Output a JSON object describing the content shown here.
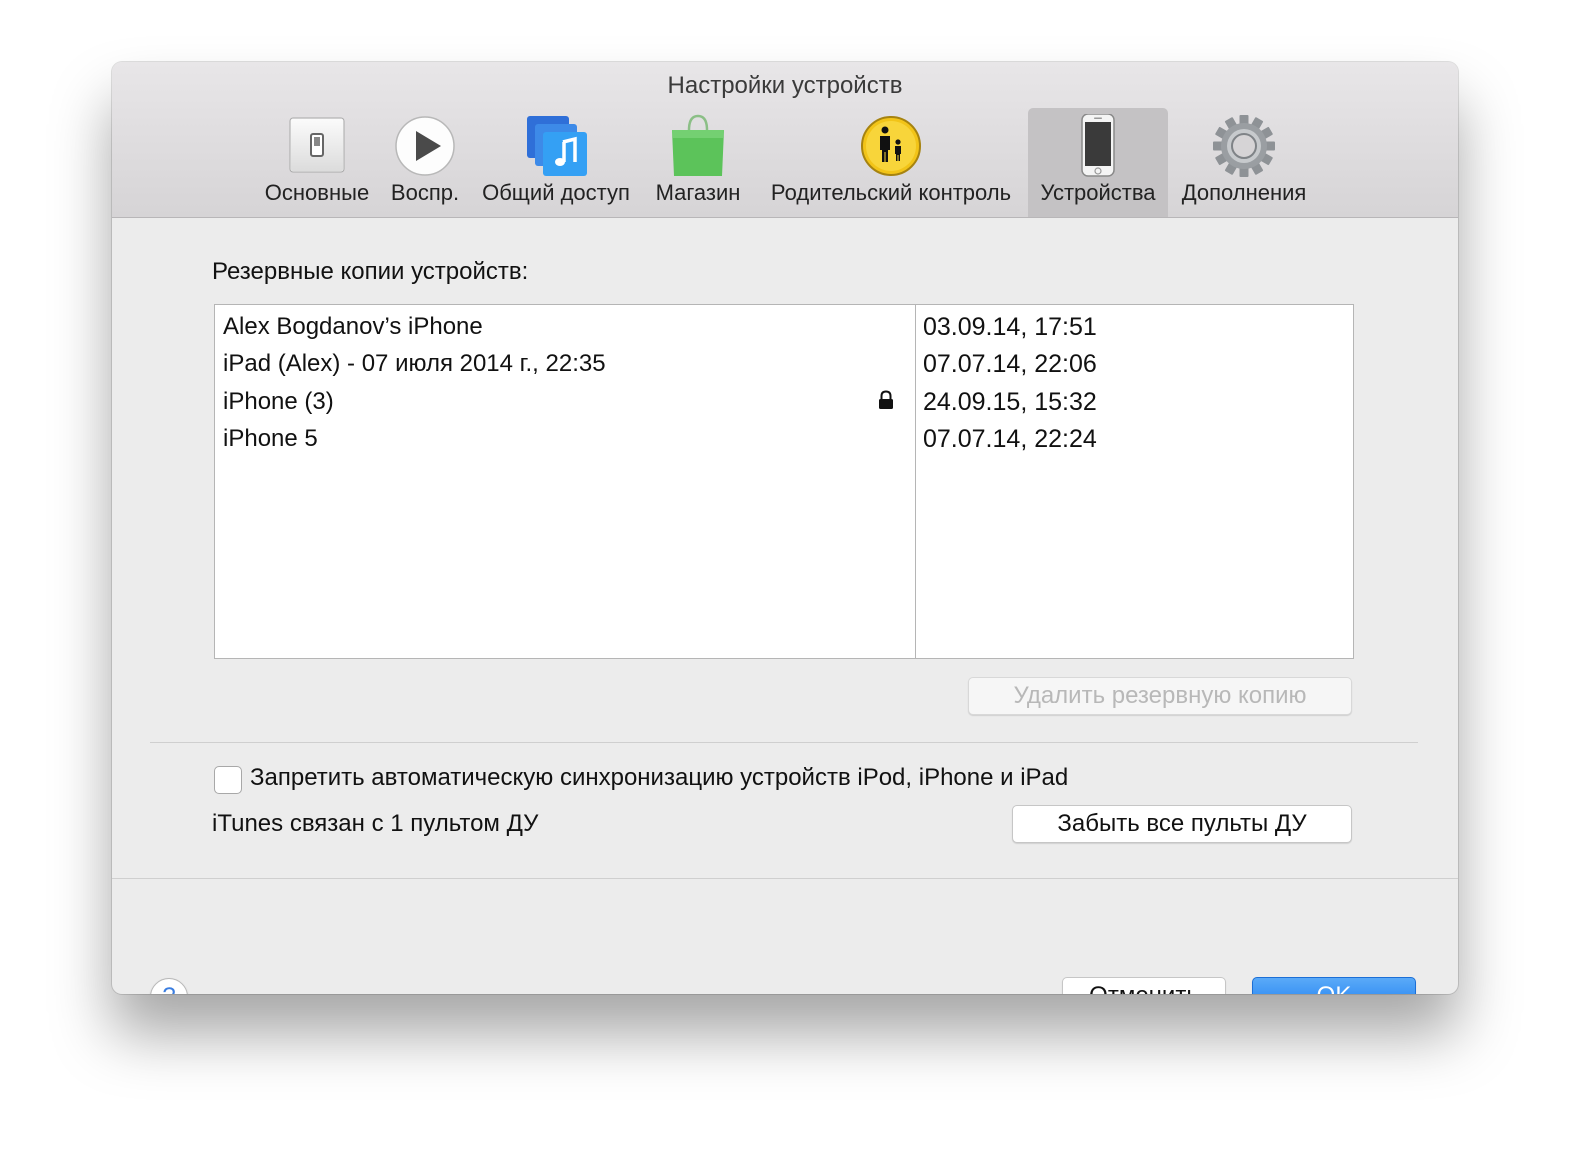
{
  "window": {
    "title": "Настройки устройств"
  },
  "toolbar": {
    "tabs": [
      {
        "label": "Основные",
        "icon": "switch-icon"
      },
      {
        "label": "Воспр.",
        "icon": "play-icon"
      },
      {
        "label": "Общий доступ",
        "icon": "music-sharing-icon"
      },
      {
        "label": "Магазин",
        "icon": "store-bag-icon"
      },
      {
        "label": "Родительский контроль",
        "icon": "parental-control-icon"
      },
      {
        "label": "Устройства",
        "icon": "iphone-icon",
        "active": true
      },
      {
        "label": "Дополнения",
        "icon": "gear-icon"
      }
    ]
  },
  "backups": {
    "label": "Резервные копии устройств:",
    "rows": [
      {
        "name": "Alex Bogdanov’s iPhone",
        "date": "03.09.14, 17:51",
        "locked": false
      },
      {
        "name": "iPad (Alex) - 07 июля 2014 г., 22:35",
        "date": "07.07.14, 22:06",
        "locked": false
      },
      {
        "name": "iPhone (3)",
        "date": "24.09.15, 15:32",
        "locked": true
      },
      {
        "name": "iPhone 5",
        "date": "07.07.14, 22:24",
        "locked": false
      }
    ],
    "delete_button": "Удалить резервную копию"
  },
  "sync": {
    "checkbox_label": "Запретить автоматическую синхронизацию устройств iPod, iPhone и iPad",
    "checked": false
  },
  "remotes": {
    "status": "iTunes связан с 1 пультом ДУ",
    "forget_button": "Забыть все пульты ДУ"
  },
  "footer": {
    "help": "?",
    "cancel": "Отменить",
    "ok": "OK"
  },
  "colors": {
    "accent": "#1a7bf0",
    "window_bg": "#ececec"
  }
}
